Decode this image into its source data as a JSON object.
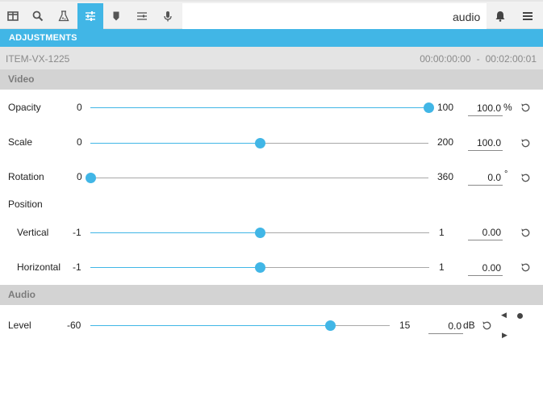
{
  "toolbar": {
    "buttons": [
      {
        "icon": "panel-layout-icon"
      },
      {
        "icon": "search-icon"
      },
      {
        "icon": "filter-flask-icon"
      },
      {
        "icon": "sliders-icon",
        "active": true
      },
      {
        "icon": "marker-icon"
      },
      {
        "icon": "list-adjust-icon"
      },
      {
        "icon": "microphone-icon"
      }
    ],
    "mode_label": "audio",
    "notification_icon": "bell-icon",
    "menu_icon": "hamburger-menu-icon"
  },
  "panel": {
    "title": "ADJUSTMENTS",
    "item_id": "ITEM-VX-1225",
    "range_start": "00:00:00:00",
    "range_sep": "-",
    "range_end": "00:02:00:01"
  },
  "sections": {
    "video": "Video",
    "audio": "Audio"
  },
  "rows": {
    "opacity": {
      "label": "Opacity",
      "min": "0",
      "max": "100",
      "value": "100.0",
      "unit": "%",
      "level": 1.0
    },
    "scale": {
      "label": "Scale",
      "min": "0",
      "max": "200",
      "value": "100.0",
      "unit": "",
      "level": 0.5
    },
    "rotation": {
      "label": "Rotation",
      "min": "0",
      "max": "360",
      "value": "0.0",
      "unit": "°",
      "level": 0.0
    },
    "position": {
      "label": "Position"
    },
    "vertical": {
      "label": "Vertical",
      "min": "-1",
      "max": "1",
      "value": "0.00",
      "unit": "",
      "level": 0.5
    },
    "horizontal": {
      "label": "Horizontal",
      "min": "-1",
      "max": "1",
      "value": "0.00",
      "unit": "",
      "level": 0.5
    },
    "level": {
      "label": "Level",
      "min": "-60",
      "max": "15",
      "value": "0.0",
      "unit": "dB",
      "level": 0.8
    }
  },
  "colors": {
    "accent": "#41b6e6",
    "section_bg": "#d3d3d3",
    "item_bar_bg": "#e4e4e4"
  },
  "keyframe_controls": {
    "prev_icon": "triangle-left-icon",
    "next_icon": "triangle-right-icon",
    "add_icon": "keyframe-dot-icon"
  }
}
